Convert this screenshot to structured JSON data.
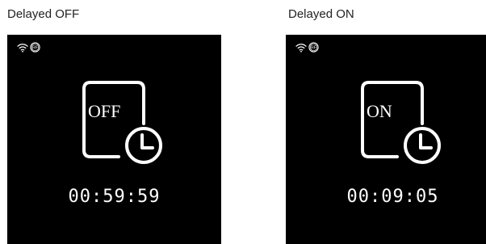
{
  "panels": [
    {
      "caption": "Delayed OFF",
      "icon_label": "OFF",
      "timer": "00:59:59",
      "status_icons": [
        "wifi-icon",
        "rf-icon"
      ]
    },
    {
      "caption": "Delayed ON",
      "icon_label": "ON",
      "timer": "00:09:05",
      "status_icons": [
        "wifi-icon",
        "rf-icon"
      ]
    }
  ],
  "rf_badge_text": "RF",
  "colors": {
    "screen_background": "#000000",
    "foreground": "#ffffff",
    "page_background": "#ffffff",
    "caption_text": "#222222"
  }
}
